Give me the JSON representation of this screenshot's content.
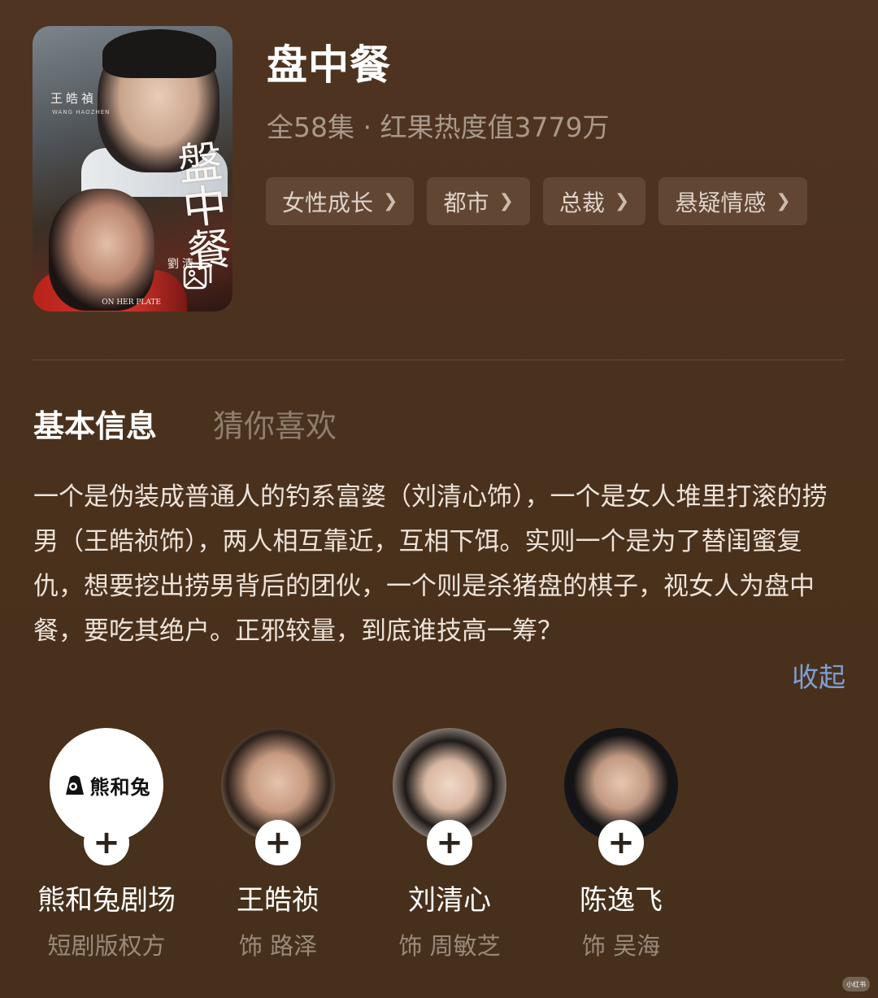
{
  "poster": {
    "actor_top_name": "王皓禎",
    "actor_top_pinyin": "WANG HAOZHEN",
    "title_script": "盤中餐",
    "actor_bottom_name": "劉清",
    "english_title": "ON HER PLATE"
  },
  "show": {
    "title": "盘中餐",
    "meta": "全58集 · 红果热度值3779万"
  },
  "tags": [
    {
      "label": "女性成长"
    },
    {
      "label": "都市"
    },
    {
      "label": "总裁"
    },
    {
      "label": "悬疑情感"
    }
  ],
  "tabs": {
    "active": "基本信息",
    "inactive": "猜你喜欢"
  },
  "description": "一个是伪装成普通人的钓系富婆（刘清心饰），一个是女人堆里打滚的捞男（王皓祯饰），两人相互靠近，互相下饵。实则一个是为了替闺蜜复仇，想要挖出捞男背后的团伙，一个则是杀猪盘的棋子，视女人为盘中餐，要吃其绝户。正邪较量，到底谁技高一筹？",
  "collapse_label": "收起",
  "cast": [
    {
      "name": "熊和兔剧场",
      "role": "短剧版权方",
      "logo_text": "熊和兔"
    },
    {
      "name": "王皓祯",
      "role": "饰 路泽"
    },
    {
      "name": "刘清心",
      "role": "饰 周敏芝"
    },
    {
      "name": "陈逸飞",
      "role": "饰 吴海"
    }
  ],
  "watermark": "小红书",
  "colors": {
    "background": "#4a311d",
    "tag_bg": "#614634",
    "link_blue": "#7f9fd4",
    "muted_text": "#a8998a"
  }
}
